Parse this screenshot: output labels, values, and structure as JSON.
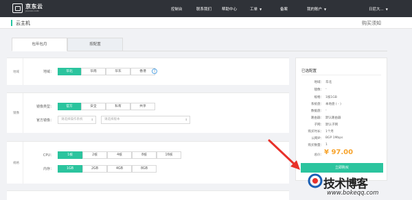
{
  "header": {
    "logo_text": "京东云",
    "logo_sub": "JCLOUD.COM",
    "nav": [
      "控制台",
      "联系我们",
      "帮助中心",
      "工单",
      "备案",
      "我的账户",
      "日尼大..."
    ]
  },
  "page": {
    "title": "云主机",
    "help": "购买须知"
  },
  "tabs": [
    {
      "label": "包年包月",
      "active": true
    },
    {
      "label": "按配置",
      "active": false
    }
  ],
  "region": {
    "section_label": "地域",
    "row_label": "地域：",
    "options": [
      "华北",
      "华南",
      "华东",
      "香港"
    ],
    "selected": "华北"
  },
  "image": {
    "section_label": "镜像",
    "type_label": "镜像类型：",
    "types": [
      "官方",
      "安全",
      "私有",
      "共享"
    ],
    "selected": "官方",
    "official_label": "官方镜像：",
    "system_placeholder": "请选择操作系统",
    "version_placeholder": "请选择版本"
  },
  "spec": {
    "section_label": "规格",
    "cpu_label": "CPU：",
    "cpu_options": [
      "1核",
      "2核",
      "4核",
      "8核",
      "16核"
    ],
    "cpu_selected": "1核",
    "mem_label": "内存：",
    "mem_options": [
      "1GB",
      "2GB",
      "4GB",
      "8GB"
    ],
    "mem_selected": "1GB"
  },
  "summary": {
    "title": "已选配置",
    "rows": [
      {
        "key": "地域：",
        "value": "华北"
      },
      {
        "key": "镜像：",
        "value": "-"
      },
      {
        "key": "规格：",
        "value": "1核1GB"
      },
      {
        "key": "系统盘：",
        "value": "本地盘 ( - )"
      },
      {
        "key": "数据盘：",
        "value": "-"
      },
      {
        "key": "路由器：",
        "value": "默认路由器"
      },
      {
        "key": "子网：",
        "value": "默认子网"
      },
      {
        "key": "购买时长：",
        "value": "1个月"
      },
      {
        "key": "公网IP：",
        "value": "BGP 1Mbps"
      },
      {
        "key": "购买数量：",
        "value": "1"
      }
    ],
    "price_label": "总价：",
    "price": "¥ 97.00",
    "button": "立即购买"
  },
  "watermark": {
    "text": "技术博客",
    "url": "www.bokeqq.com"
  },
  "colors": {
    "accent": "#2bc49e",
    "topbar": "#2f3238",
    "price": "#f7a32b",
    "arrow": "#e8312a"
  }
}
